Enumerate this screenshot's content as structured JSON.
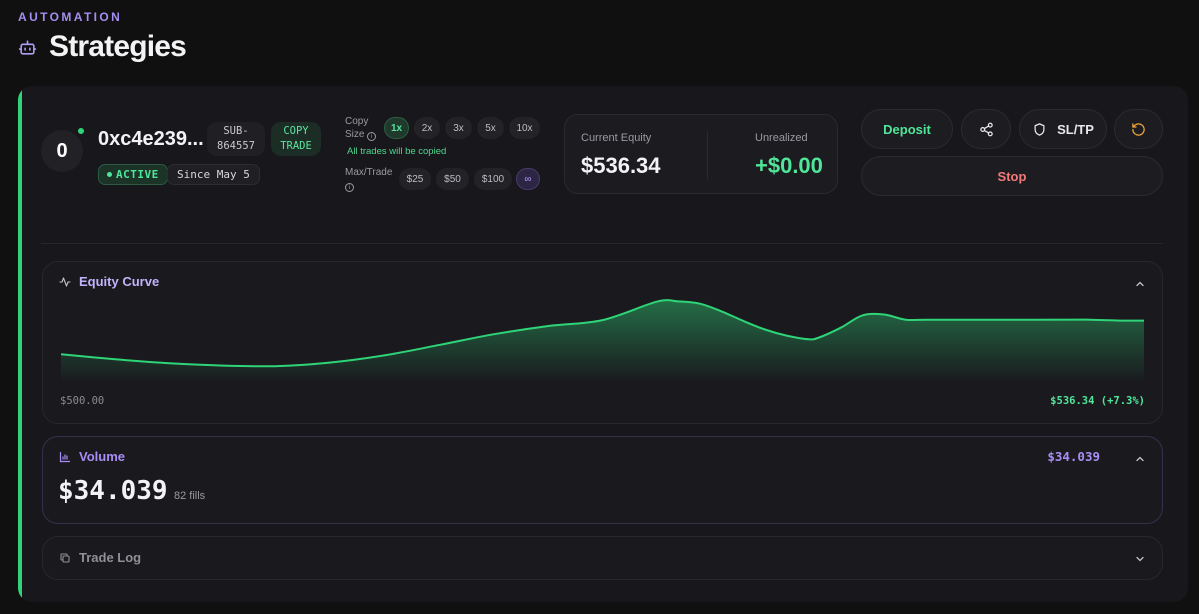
{
  "header": {
    "section": "AUTOMATION",
    "title": "Strategies",
    "icon": "bot-icon"
  },
  "strategy": {
    "avatar_text": "0",
    "address": "0xc4e239...",
    "sub_line1": "SUB-",
    "sub_line2": "864557",
    "mode_line1": "COPY",
    "mode_line2": "TRADE",
    "status": "ACTIVE",
    "since": "Since May 5",
    "copy_size_label_1": "Copy",
    "copy_size_label_2": "Size",
    "copy_size_options": [
      "1x",
      "2x",
      "3x",
      "5x",
      "10x"
    ],
    "copy_size_selected": "1x",
    "copy_note": "All trades will be copied",
    "max_trade_label": "Max/Trade",
    "max_trade_options": [
      "$25",
      "$50",
      "$100",
      "∞"
    ],
    "max_trade_selected": "∞",
    "current_equity_label": "Current Equity",
    "current_equity": "$536.34",
    "unrealized_label": "Unrealized",
    "unrealized": "+$0.00",
    "buttons": {
      "deposit": "Deposit",
      "sltp": "SL/TP",
      "stop": "Stop"
    }
  },
  "equity_curve": {
    "title": "Equity Curve",
    "start_label": "$500.00",
    "end_label": "$536.34 (+7.3%)"
  },
  "volume": {
    "title": "Volume",
    "value": "$34.039",
    "fills": "82 fills",
    "header_value": "$34.039"
  },
  "trade_log": {
    "title": "Trade Log"
  },
  "colors": {
    "accent_green": "#2ed477",
    "accent_purple": "#a98df6",
    "stop_red": "#f07a7a",
    "deposit_green": "#4fe69a"
  },
  "chart_data": {
    "type": "area",
    "ylabel": "",
    "xlabel": "",
    "x": [
      0,
      5,
      10,
      15,
      20,
      25,
      30,
      35,
      40,
      45,
      50,
      55,
      57,
      59,
      61,
      63,
      65,
      67,
      69,
      70,
      72,
      74,
      76,
      78,
      80,
      90,
      95,
      98,
      100
    ],
    "y": [
      511.5,
      507.6,
      504.5,
      502.7,
      502.3,
      505.2,
      510.8,
      518.8,
      527.0,
      533.3,
      537.9,
      552.1,
      552.4,
      550.6,
      544.6,
      537.3,
      530.6,
      525.9,
      523.1,
      524.4,
      532.0,
      541.5,
      542.2,
      538.2,
      538.2,
      538.2,
      538.2,
      537.5,
      537.5
    ],
    "ylim": [
      490,
      555
    ],
    "grid": false,
    "legend": "none"
  }
}
